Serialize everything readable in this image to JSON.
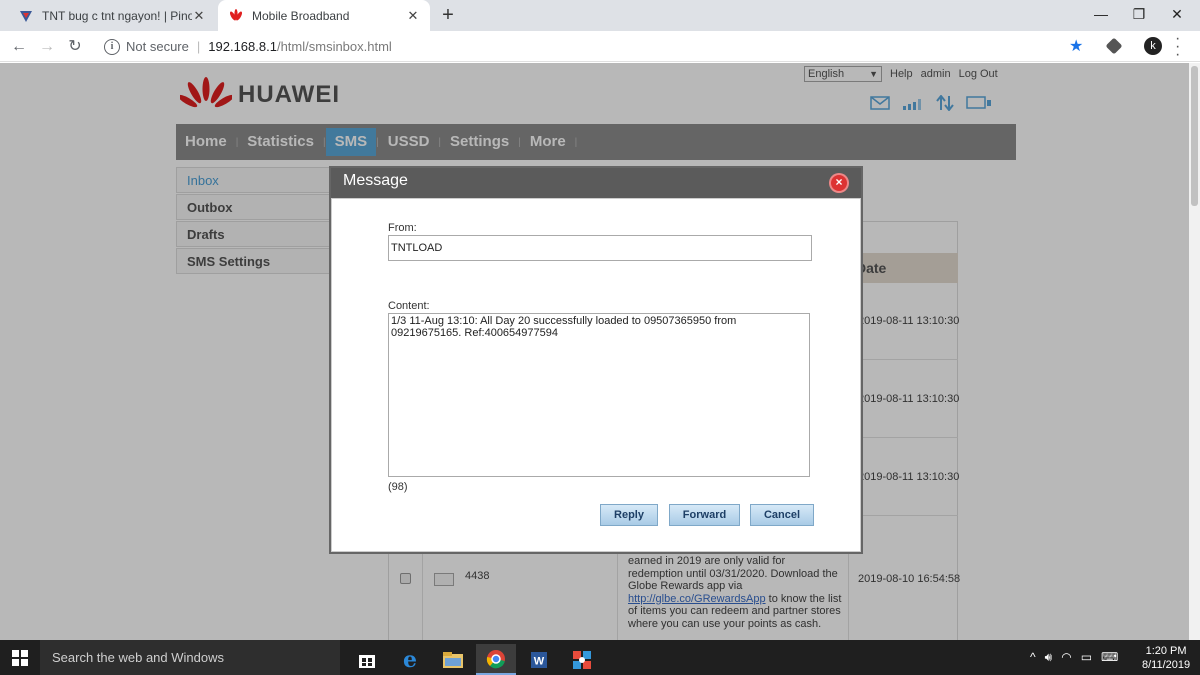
{
  "browser": {
    "tabs": [
      {
        "title": "TNT bug c tnt ngayon! | Pinoy Int",
        "close": "✕"
      },
      {
        "title": "Mobile Broadband",
        "close": "✕"
      }
    ],
    "new_tab": "+",
    "address": {
      "security": "Not secure",
      "host": "192.168.8.1",
      "path": "/html/smsinbox.html"
    },
    "profile_initial": "k"
  },
  "router": {
    "language": "English",
    "top_links": [
      "Help",
      "admin",
      "Log Out"
    ],
    "brand": "HUAWEI",
    "nav": [
      "Home",
      "Statistics",
      "SMS",
      "USSD",
      "Settings",
      "More"
    ],
    "active_nav": "SMS",
    "side_menu": [
      "Inbox",
      "Outbox",
      "Drafts",
      "SMS Settings"
    ],
    "table": {
      "date_header": "Date",
      "dates": [
        "2019-08-11 13:10:30",
        "2019-08-11 13:10:30",
        "2019-08-11 13:10:30",
        "2019-08-10 16:54:58"
      ],
      "sender_4": "4438",
      "message_4_pre": "earned in 2019 are only valid for redemption until 03/31/2020. Download the Globe Rewards app via ",
      "message_4_link": "http://glbe.co/GRewardsApp",
      "message_4_post": " to know the list of items you can redeem and partner stores where you can use your points as cash."
    }
  },
  "dialog": {
    "title": "Message",
    "from_label": "From:",
    "from_value": "TNTLOAD",
    "content_label": "Content:",
    "content_value": "1/3 11-Aug 13:10: All Day 20 successfully loaded to 09507365950 from 09219675165. Ref:400654977594",
    "char_count": "(98)",
    "buttons": {
      "reply": "Reply",
      "forward": "Forward",
      "cancel": "Cancel"
    }
  },
  "taskbar": {
    "search_placeholder": "Search the web and Windows",
    "time": "1:20 PM",
    "date": "8/11/2019"
  }
}
